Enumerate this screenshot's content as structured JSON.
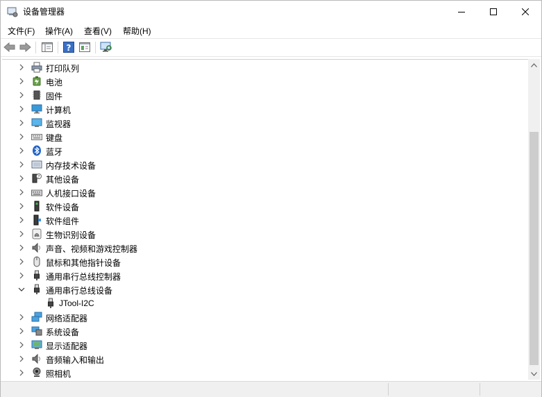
{
  "window": {
    "title": "设备管理器"
  },
  "menu": [
    "文件(F)",
    "操作(A)",
    "查看(V)",
    "帮助(H)"
  ],
  "icons": {
    "app": "device-manager-icon",
    "toolbar": [
      "back-arrow-icon",
      "forward-arrow-icon",
      "properties-icon",
      "help-icon",
      "show-hide-console-tree-icon",
      "scan-hardware-icon"
    ]
  },
  "tree": {
    "items": [
      {
        "label": "打印队列",
        "icon": "printer-icon",
        "expanded": false
      },
      {
        "label": "电池",
        "icon": "battery-icon",
        "expanded": false
      },
      {
        "label": "固件",
        "icon": "firmware-icon",
        "expanded": false
      },
      {
        "label": "计算机",
        "icon": "computer-icon",
        "expanded": false
      },
      {
        "label": "监视器",
        "icon": "monitor-icon",
        "expanded": false
      },
      {
        "label": "键盘",
        "icon": "keyboard-icon",
        "expanded": false
      },
      {
        "label": "蓝牙",
        "icon": "bluetooth-icon",
        "expanded": false
      },
      {
        "label": "内存技术设备",
        "icon": "memory-device-icon",
        "expanded": false
      },
      {
        "label": "其他设备",
        "icon": "other-device-icon",
        "expanded": false
      },
      {
        "label": "人机接口设备",
        "icon": "hid-icon",
        "expanded": false
      },
      {
        "label": "软件设备",
        "icon": "software-device-icon",
        "expanded": false
      },
      {
        "label": "软件组件",
        "icon": "software-component-icon",
        "expanded": false
      },
      {
        "label": "生物识别设备",
        "icon": "biometric-icon",
        "expanded": false
      },
      {
        "label": "声音、视频和游戏控制器",
        "icon": "speaker-icon",
        "expanded": false
      },
      {
        "label": "鼠标和其他指针设备",
        "icon": "mouse-icon",
        "expanded": false
      },
      {
        "label": "通用串行总线控制器",
        "icon": "usb-icon",
        "expanded": false
      },
      {
        "label": "通用串行总线设备",
        "icon": "usb-icon",
        "expanded": true
      },
      {
        "label": "JTool-I2C",
        "icon": "usb-icon",
        "child": true
      },
      {
        "label": "网络适配器",
        "icon": "network-adapter-icon",
        "expanded": false
      },
      {
        "label": "系统设备",
        "icon": "system-device-icon",
        "expanded": false
      },
      {
        "label": "显示适配器",
        "icon": "display-adapter-icon",
        "expanded": false
      },
      {
        "label": "音频输入和输出",
        "icon": "speaker-icon",
        "expanded": false
      },
      {
        "label": "照相机",
        "icon": "camera-icon",
        "expanded": false
      }
    ]
  }
}
